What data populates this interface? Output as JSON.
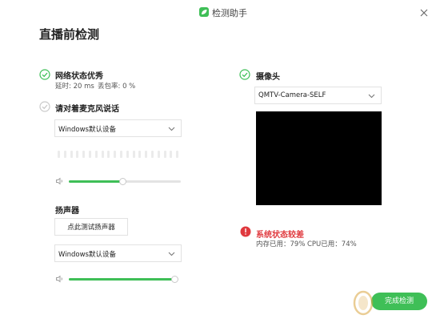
{
  "window": {
    "title": "检测助手",
    "close_icon": "close-icon"
  },
  "page_title": "直播前检测",
  "colors": {
    "accent": "#3fbf57",
    "error": "#e0393e",
    "muted": "#c9c9c9"
  },
  "network": {
    "status": "网络状态优秀",
    "latency_text": "延时: 20 ms",
    "loss_text": "丢包率: 0 %"
  },
  "microphone": {
    "prompt": "请对着麦克风说话",
    "device": "Windows默认设备",
    "volume": 0.48
  },
  "speaker": {
    "title": "扬声器",
    "test_button": "点此测试扬声器",
    "device": "Windows默认设备",
    "volume": 0.98
  },
  "camera": {
    "title": "摄像头",
    "device": "QMTV-Camera-SELF"
  },
  "system": {
    "status": "系统状态较差",
    "memory_text": "内存已用：79%",
    "cpu_text": "CPU已用：74%"
  },
  "finish_button": "完成检测"
}
